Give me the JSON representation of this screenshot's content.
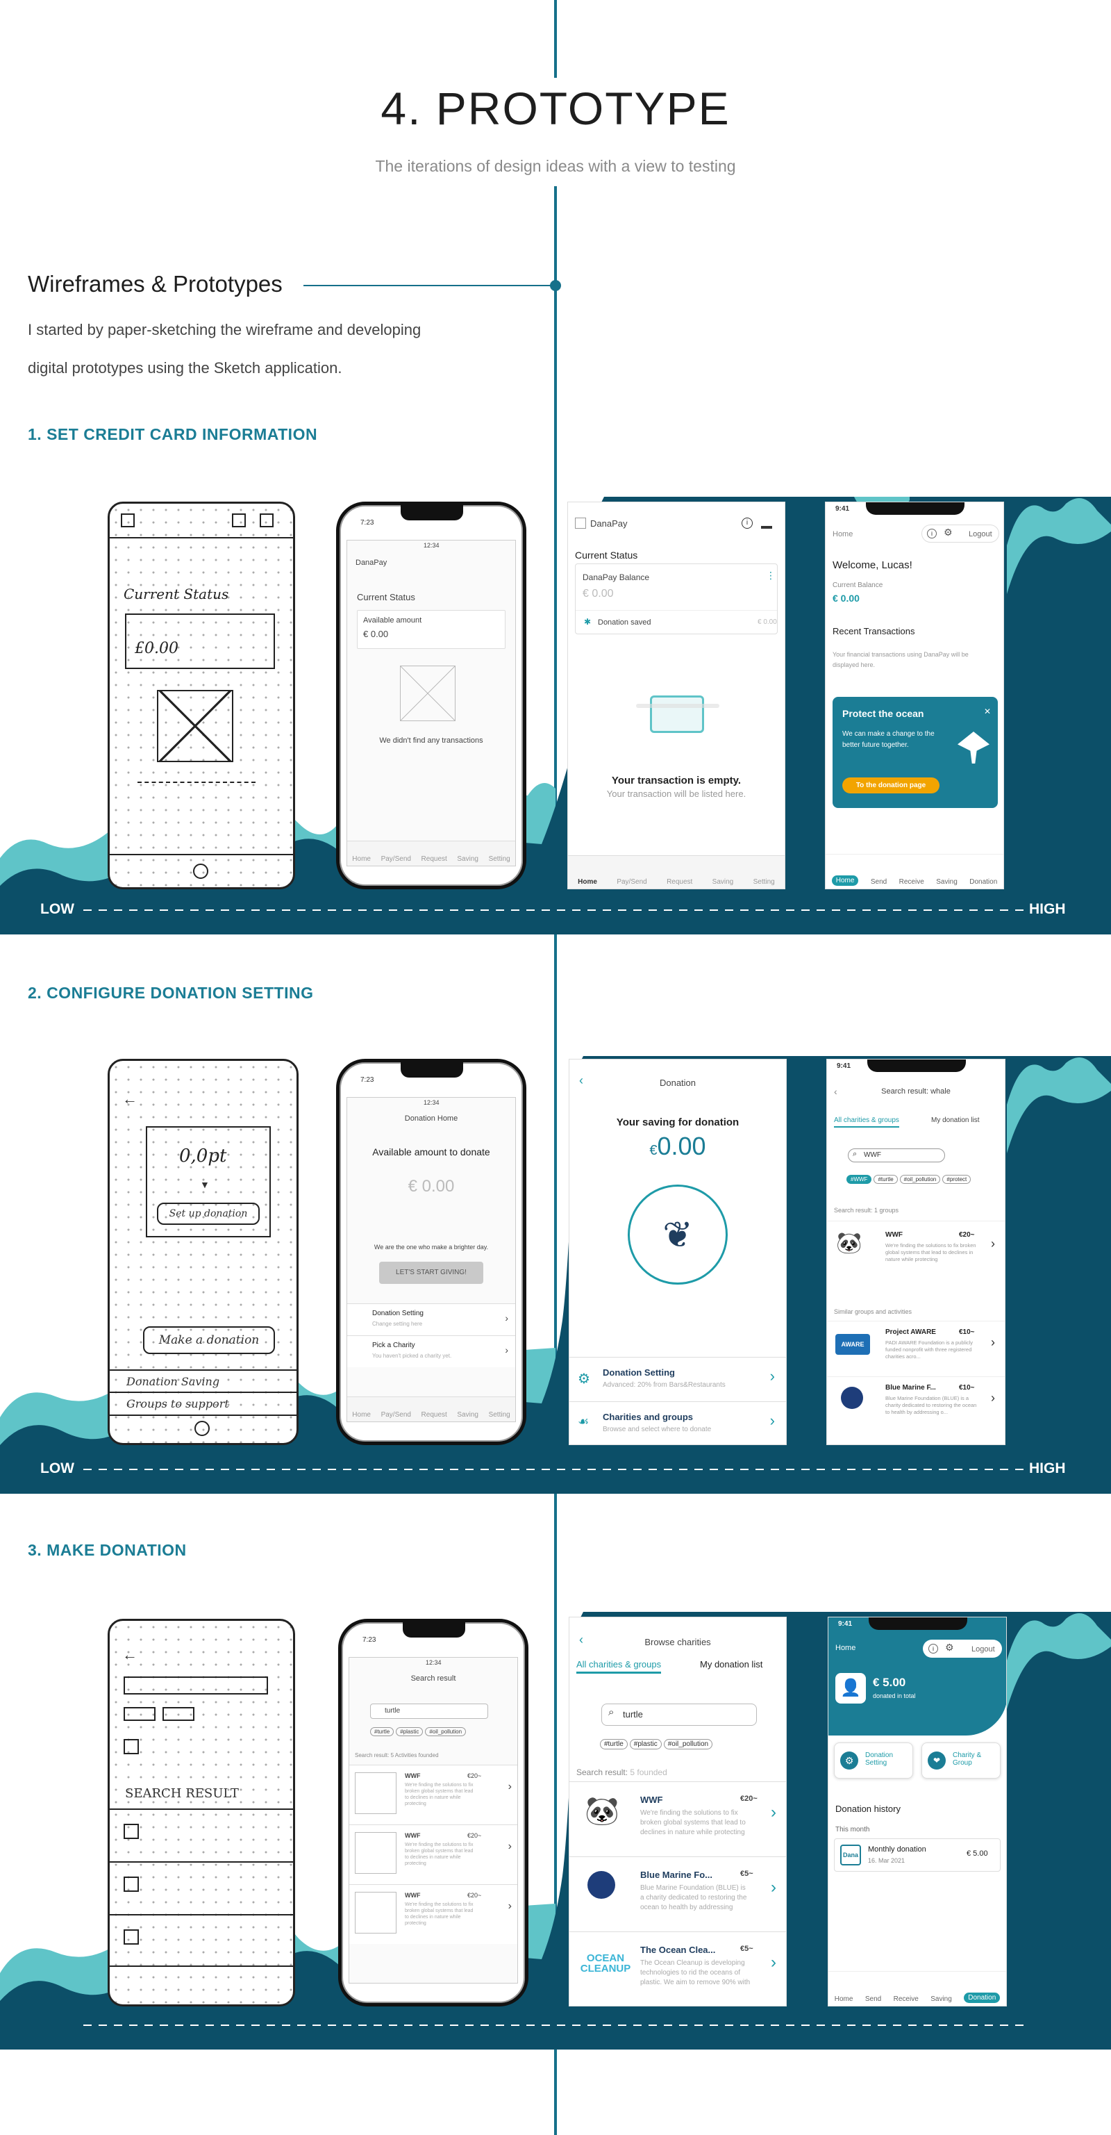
{
  "header": {
    "title": "4. PROTOTYPE",
    "subtitle": "The iterations of design ideas with a view to testing"
  },
  "intro": {
    "heading": "Wireframes & Prototypes",
    "line1": "I started  by paper-sketching the wireframe and developing",
    "line2": "digital prototypes using the Sketch application."
  },
  "scale": {
    "low": "LOW",
    "high": "HIGH"
  },
  "sections": [
    {
      "title": "1. SET CREDIT CARD INFORMATION"
    },
    {
      "title": "2. CONFIGURE DONATION SETTING"
    },
    {
      "title": "3. MAKE DONATION"
    }
  ],
  "colors": {
    "accent": "#15708a",
    "wave_dark": "#0c4f68",
    "wave_light": "#5fc4c8",
    "brand_teal": "#1e9ba8",
    "cta": "#f2a400"
  },
  "s1": {
    "sketch": {
      "status": "Current Status",
      "amount": "£0.00"
    },
    "lofi": {
      "time": "7:23",
      "time2": "12:34",
      "app": "DanaPay",
      "status": "Current Status",
      "avail": "Available amount",
      "amount": "€ 0.00",
      "empty": "We didn't find any transactions",
      "tabs": [
        "Home",
        "Pay/Send",
        "Request",
        "Saving",
        "Setting"
      ]
    },
    "mid": {
      "app": "DanaPay",
      "status": "Current Status",
      "balance": "DanaPay Balance",
      "amount": "€ 0.00",
      "saved": "Donation saved",
      "saved_val": "€ 0.00",
      "empty_title": "Your transaction is empty.",
      "empty_sub": "Your transaction will be listed here.",
      "tabs": [
        "Home",
        "Pay/Send",
        "Request",
        "Saving",
        "Setting"
      ]
    },
    "hi": {
      "time": "9:41",
      "home": "Home",
      "logout": "Logout",
      "welcome": "Welcome, Lucas!",
      "bal_label": "Current Balance",
      "bal": "€ 0.00",
      "recent": "Recent Transactions",
      "recent_sub": "Your financial transactions using DanaPay will be displayed here.",
      "promo_title": "Protect the ocean",
      "promo_text": "We can make a change to the better future together.",
      "promo_btn": "To the donation page",
      "tabs": [
        "Home",
        "Send",
        "Receive",
        "Saving",
        "Donation"
      ]
    }
  },
  "s2": {
    "sketch": {
      "amount": "0,0pt",
      "setup": "Set up donation",
      "make": "Make a donation",
      "setting": "Donation Saving",
      "groups": "Groups to support"
    },
    "lofi": {
      "time": "7:23",
      "time2": "12:34",
      "title": "Donation Home",
      "avail": "Available amount to donate",
      "amount": "€ 0.00",
      "tagline": "We are the one who make a brighter day.",
      "cta": "LET'S START GIVING!",
      "row1": "Donation Setting",
      "row1sub": "Change setting here",
      "row2": "Pick a Charity",
      "row2sub": "You haven't picked a charity yet.",
      "tabs": [
        "Home",
        "Pay/Send",
        "Request",
        "Saving",
        "Setting"
      ]
    },
    "mid": {
      "title": "Donation",
      "saving": "Your saving for donation",
      "amount": "0.00",
      "cur": "€",
      "row1": "Donation Setting",
      "row1sub": "Advanced: 20% from Bars&Restaurants",
      "row2": "Charities and groups",
      "row2sub": "Browse and select where to donate"
    },
    "hi": {
      "time": "9:41",
      "title": "Search result: whale",
      "tab1": "All charities & groups",
      "tab2": "My donation list",
      "search": "WWF",
      "tags": [
        "#WWF",
        "#turtle",
        "#oil_pollution",
        "#protect"
      ],
      "count": "Search result: 1 groups",
      "wwf": "WWF",
      "wwf_amt": "€20~",
      "wwf_text": "We're finding the solutions to fix broken global systems that lead to declines in nature while protecting",
      "similar": "Similar groups and activities",
      "aware": "Project AWARE",
      "aware_amt": "€10~",
      "aware_text": "PADI AWARE Foundation is a publicly funded nonprofit with three registered charities acro...",
      "blue": "Blue Marine F...",
      "blue_amt": "€10~",
      "blue_text": "Blue Marine Foundation (BLUE) is a charity dedicated to restoring the ocean to health by addressing o..."
    }
  },
  "s3": {
    "sketch": {
      "result": "SEARCH RESULT"
    },
    "lofi": {
      "time": "7:23",
      "time2": "12:34",
      "title": "Search result",
      "search": "turtle",
      "tags": [
        "#turtle",
        "#plastic",
        "#oil_pollution"
      ],
      "count": "Search result: 5 Activities founded",
      "name": "WWF",
      "amt": "€20~",
      "text": "We're finding the solutions to fix broken global systems that lead to declines in nature while protecting"
    },
    "mid": {
      "title": "Browse charities",
      "tab1": "All charities & groups",
      "tab2": "My donation list",
      "search": "turtle",
      "tags": [
        "#turtle",
        "#plastic",
        "#oil_pollution"
      ],
      "count": "Search result:",
      "count_val": "5 founded",
      "items": [
        {
          "name": "WWF",
          "amt": "€20~",
          "text": "We're finding the solutions to fix broken global systems that lead to declines in nature while protecting"
        },
        {
          "name": "Blue Marine Fo...",
          "amt": "€5~",
          "text": "Blue Marine Foundation (BLUE) is a charity dedicated to restoring the ocean to health by addressing"
        },
        {
          "name": "The Ocean Clea...",
          "amt": "€5~",
          "text": "The Ocean Cleanup is developing technologies to rid the oceans of plastic. We aim to remove 90% with"
        }
      ]
    },
    "hi": {
      "time": "9:41",
      "home": "Home",
      "logout": "Logout",
      "amount": "€ 5.00",
      "donated": "donated in total",
      "btn1": "Donation Setting",
      "btn2": "Charity & Group",
      "history": "Donation history",
      "month": "This month",
      "item": "Monthly donation",
      "date": "16. Mar 2021",
      "item_amt": "€ 5.00",
      "dana": "Dana",
      "tabs": [
        "Home",
        "Send",
        "Receive",
        "Saving",
        "Donation"
      ]
    }
  }
}
